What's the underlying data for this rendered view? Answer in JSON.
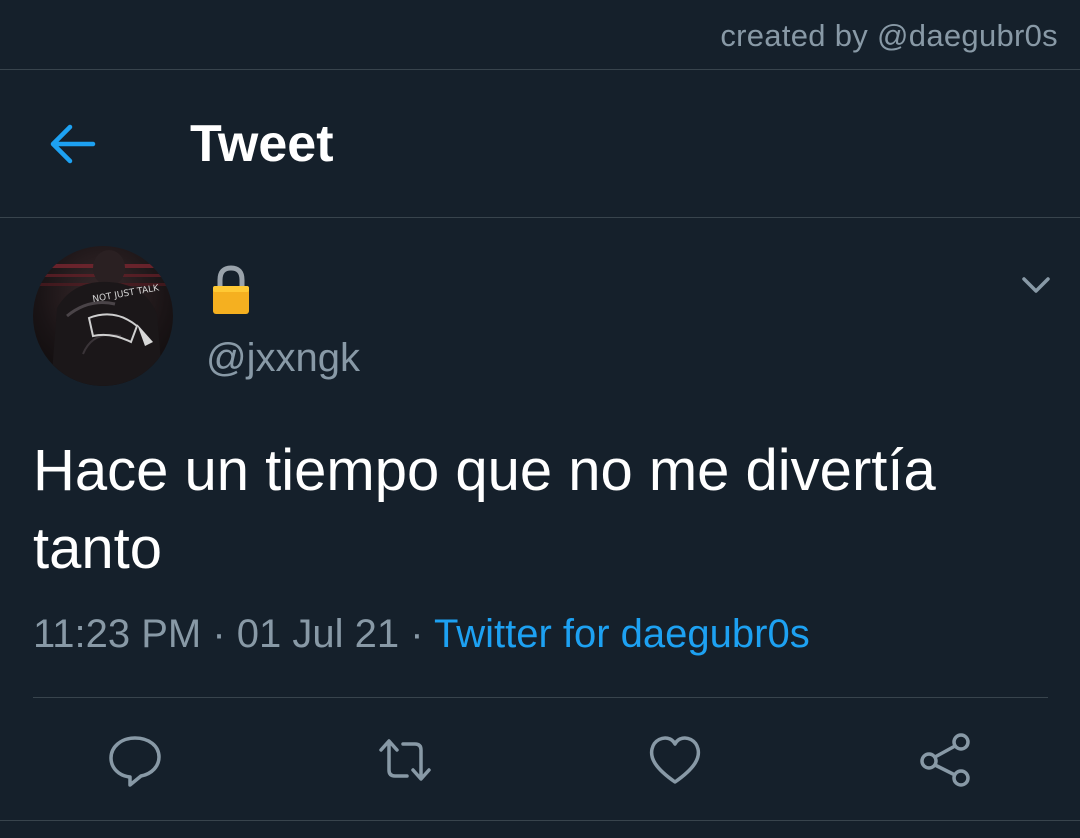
{
  "credit": "created by @daegubr0s",
  "header": {
    "title": "Tweet",
    "back_icon": "arrow-left-icon"
  },
  "tweet": {
    "display_name_icon": "lock-icon",
    "handle": "@jxxngk",
    "text": "Hace un tiempo que no me divertía tanto",
    "time": "11:23 PM",
    "separator": " · ",
    "date": "01 Jul 21",
    "source": "Twitter for daegubr0s"
  },
  "actions": [
    {
      "name": "reply",
      "icon": "comment-icon"
    },
    {
      "name": "retweet",
      "icon": "retweet-icon"
    },
    {
      "name": "like",
      "icon": "heart-icon"
    },
    {
      "name": "share",
      "icon": "share-icon"
    }
  ],
  "colors": {
    "background": "#15202b",
    "accent": "#1da1f2",
    "secondary_text": "#8899a6",
    "divider": "#38444d"
  }
}
